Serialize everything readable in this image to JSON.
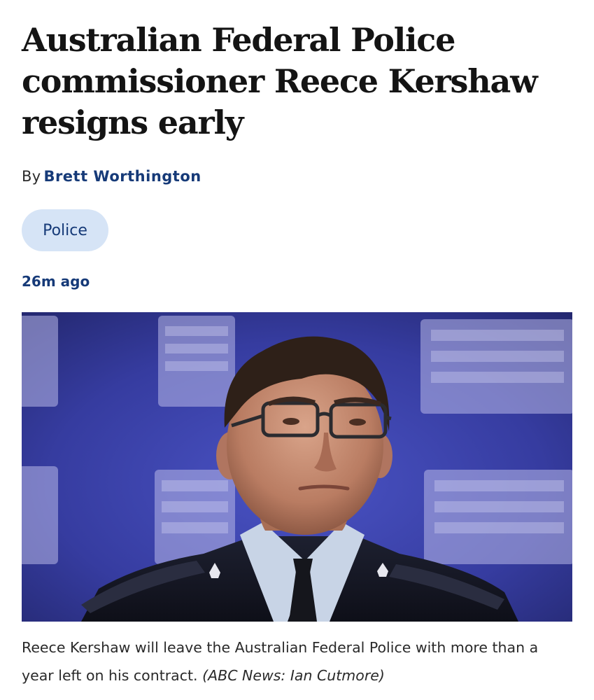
{
  "article": {
    "headline": "Australian Federal Police commissioner Reece Kershaw resigns early",
    "byline_prefix": "By",
    "author": "Brett Worthington",
    "tag": "Police",
    "timestamp": "26m ago"
  },
  "photo": {
    "caption": "Reece Kershaw will leave the Australian Federal Police with more than a year left on his contract.",
    "credit": "(ABC News: Ian Cutmore)"
  },
  "colors": {
    "link_blue": "#163a78",
    "tag_background": "#d6e4f6",
    "photo_backdrop": "#3a3fa8"
  }
}
